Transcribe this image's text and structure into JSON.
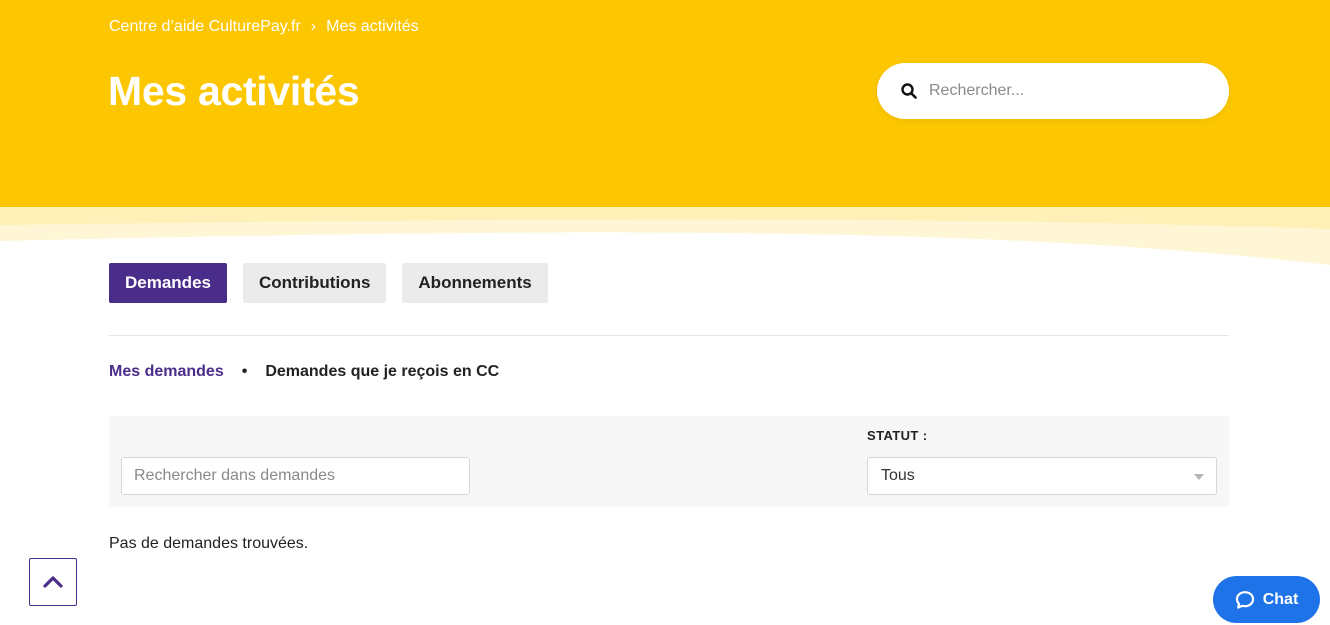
{
  "header": {
    "breadcrumb": {
      "root": "Centre d’aide CulturePay.fr",
      "separator": "›",
      "current": "Mes activités"
    },
    "title": "Mes activités",
    "search": {
      "placeholder": "Rechercher..."
    }
  },
  "tabs": [
    {
      "label": "Demandes",
      "active": true
    },
    {
      "label": "Contributions",
      "active": false
    },
    {
      "label": "Abonnements",
      "active": false
    }
  ],
  "subnav": {
    "items": [
      {
        "label": "Mes demandes",
        "active": true
      },
      {
        "label": "Demandes que je reçois en CC",
        "active": false
      }
    ],
    "separator": "•"
  },
  "filters": {
    "search_placeholder": "Rechercher dans demandes",
    "status_label": "STATUT :",
    "status_value": "Tous"
  },
  "empty_message": "Pas de demandes trouvées.",
  "chat": {
    "label": "Chat"
  },
  "colors": {
    "brand_yellow": "#fcc600",
    "accent_purple": "#4a2c8a",
    "chat_blue": "#1f73e8"
  },
  "icons": {
    "search": "search-icon",
    "scroll_top": "chevron-up-icon",
    "chat": "chat-bubble-icon"
  }
}
